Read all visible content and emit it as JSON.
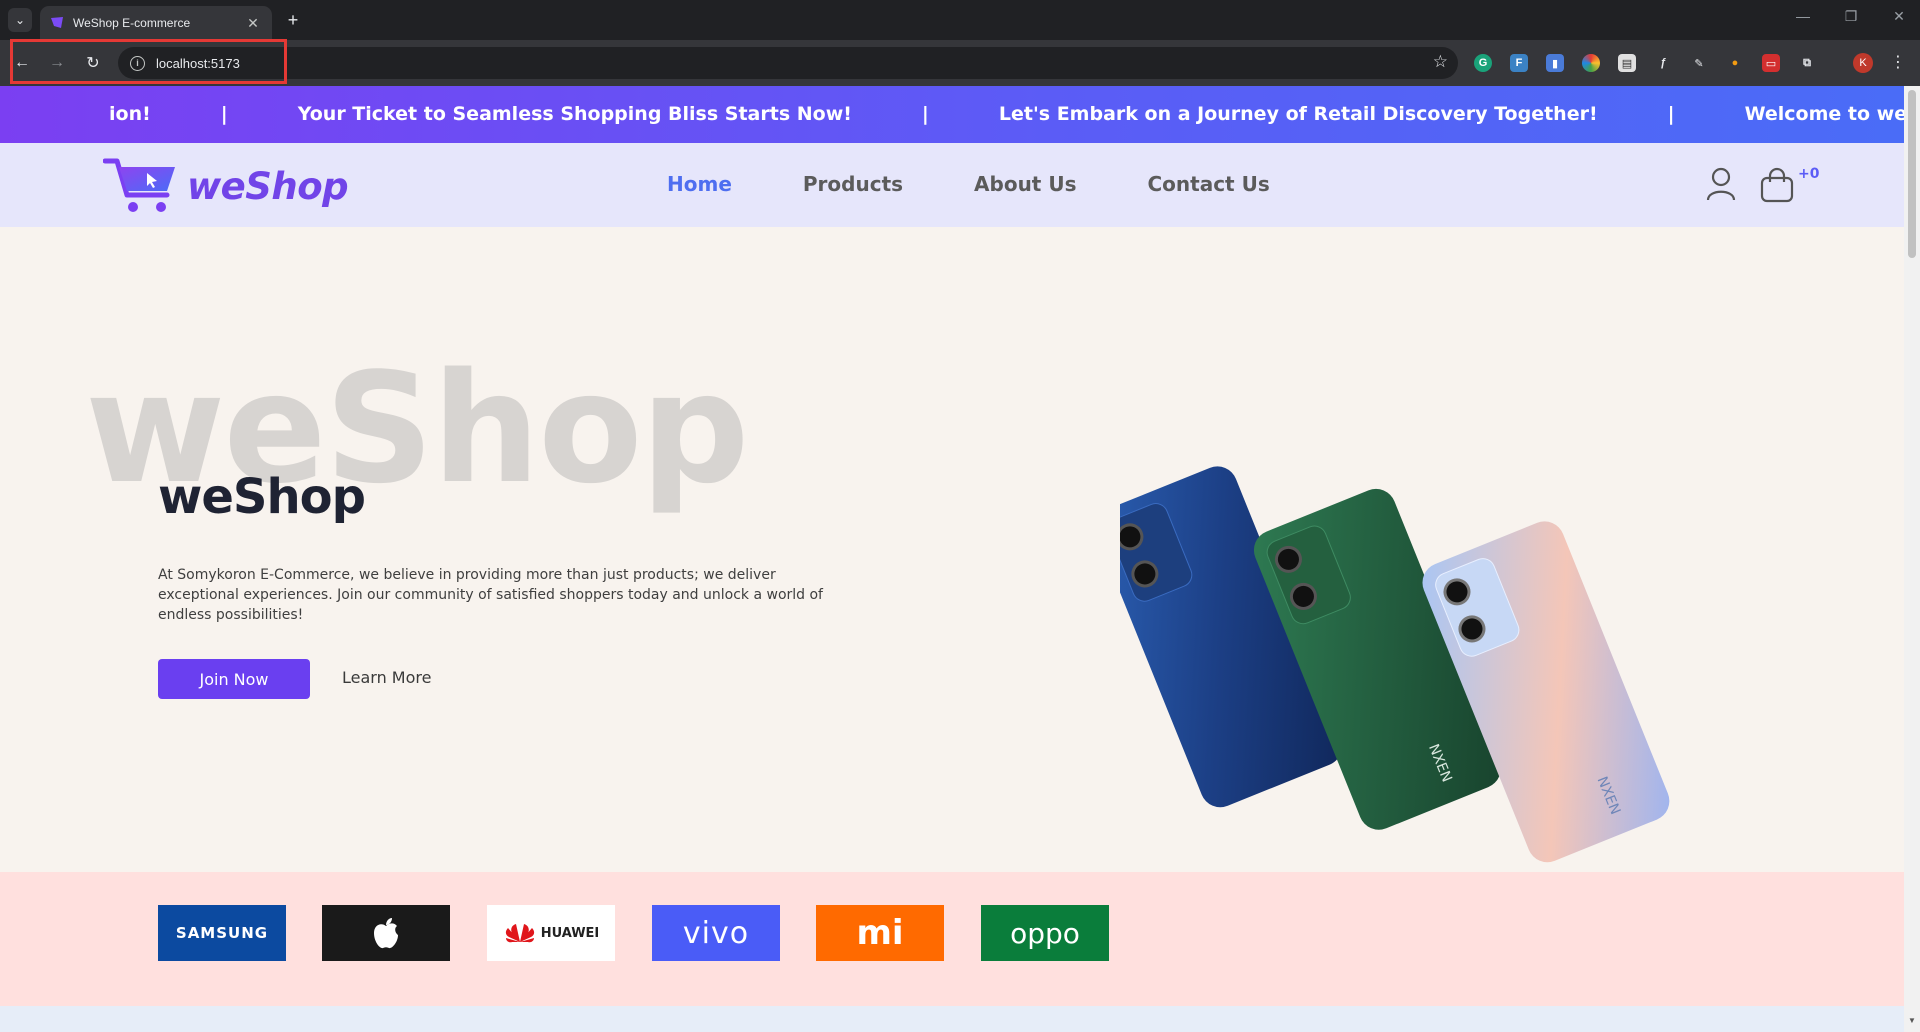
{
  "browser": {
    "tab_title": "WeShop E-commerce",
    "url": "localhost:5173",
    "profile_initial": "K"
  },
  "marquee": {
    "messages": [
      "ion!",
      "Your Ticket to Seamless Shopping Bliss Starts Now!",
      "Let's Embark on a Journey of Retail Discovery Together!",
      "Welcome to weShop. Your Ult"
    ],
    "separator": "|"
  },
  "header": {
    "logo_text": "weShop",
    "nav": [
      {
        "label": "Home",
        "active": true
      },
      {
        "label": "Products",
        "active": false
      },
      {
        "label": "About Us",
        "active": false
      },
      {
        "label": "Contact Us",
        "active": false
      }
    ],
    "cart_count": "+0"
  },
  "hero": {
    "bg_text": "weShop",
    "title": "weShop",
    "description": "At Somykoron E-Commerce, we believe in providing more than just products; we deliver exceptional experiences. Join our community of satisfied shoppers today and unlock a world of endless possibilities!",
    "primary_button": "Join Now",
    "secondary_button": "Learn More",
    "phone_brand": "NXEN"
  },
  "brands": [
    "SAMSUNG",
    "Apple",
    "HUAWEI",
    "vivo",
    "mi",
    "oppo"
  ],
  "colors": {
    "accent": "#6a3ff0",
    "nav_active": "#4e6ef0",
    "hero_bg": "#f8f3ee",
    "header_bg": "#e6e6fb",
    "brands_bg": "#ffe0de"
  }
}
